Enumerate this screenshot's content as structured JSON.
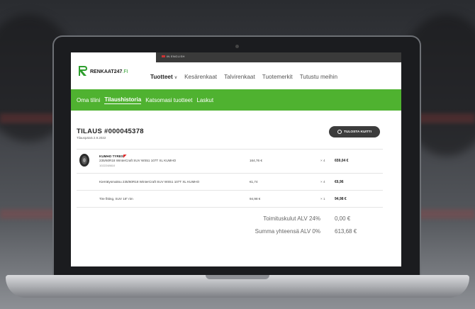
{
  "site": {
    "language_link": "IN ENGLISH",
    "logo_name": "RENKAAT247",
    "logo_suffix": ".FI"
  },
  "nav": {
    "items": [
      {
        "label": "Tuotteet",
        "active": true
      },
      {
        "label": "Kesärenkaat"
      },
      {
        "label": "Talvirenkaat"
      },
      {
        "label": "Tuotemerkit"
      },
      {
        "label": "Tutustu meihin"
      }
    ]
  },
  "account_tabs": [
    {
      "label": "Oma tilini"
    },
    {
      "label": "Tilaushistoria",
      "active": true
    },
    {
      "label": "Katsomasi tuotteet"
    },
    {
      "label": "Laskut"
    }
  ],
  "order": {
    "title": "TILAUS #000045378",
    "date": "Tilauspäivä 2.9.2022",
    "print_label": "TULOSTA KUITTI"
  },
  "lines": [
    {
      "brand": "KUMHO TYRES",
      "description": "235/60R18 WinterCraft SUV WS51 107T XL KUMHO",
      "code": "1022248610",
      "price": "164,76 €",
      "qty": "× 4",
      "total": "659,04 €"
    },
    {
      "description": "Kierrätysmaksu 235/60R18 WinterCraft SUV WS51 107T XL KUMHO",
      "price": "€1,74",
      "qty": "× 4",
      "total": "€6,96"
    },
    {
      "description": "Tire fitting, SUV 18\" rim",
      "price": "94,98 €",
      "qty": "× 1",
      "total": "94,98 €"
    }
  ],
  "summary": {
    "shipping_label": "Toimituskulut ALV 24%",
    "shipping_value": "0,00 €",
    "total_label": "Summa yhteensä ALV 0%",
    "total_value": "613,68 €"
  },
  "colors": {
    "accent_green": "#4fb230",
    "header_dark": "#3a3a3a",
    "print_button": "#3c3c3c"
  }
}
